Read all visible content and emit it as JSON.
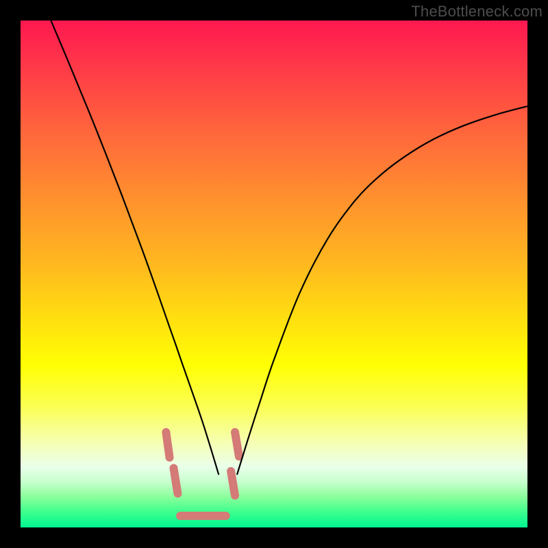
{
  "watermark": "TheBottleneck.com",
  "chart_data": {
    "type": "line",
    "title": "",
    "xlabel": "",
    "ylabel": "",
    "xlim": [
      0,
      100
    ],
    "ylim": [
      0,
      100
    ],
    "series": [
      {
        "name": "left-branch",
        "x": [
          6,
          10,
          15,
          20,
          24,
          27,
          29.4,
          30.6,
          31.8,
          33.1,
          34.5,
          36.0,
          37.5,
          39.1
        ],
        "values": [
          100,
          90.5,
          78.3,
          65.5,
          54.8,
          46.4,
          39.5,
          36.1,
          32.6,
          28.9,
          24.9,
          20.5,
          15.7,
          10.4
        ]
      },
      {
        "name": "right-branch",
        "x": [
          42.7,
          44.8,
          47.4,
          50.0,
          55.0,
          60.5,
          66.0,
          71.0,
          76.0,
          81.5,
          87.5,
          94.0,
          100.0
        ],
        "values": [
          10.4,
          17.2,
          25.3,
          33.1,
          46.1,
          56.8,
          64.5,
          69.5,
          73.3,
          76.6,
          79.3,
          81.5,
          83.1
        ]
      },
      {
        "name": "connector-pill-left-outer",
        "x": [
          28.7,
          29.4
        ],
        "values": [
          18.8,
          13.8
        ]
      },
      {
        "name": "connector-pill-left-inner",
        "x": [
          30.2,
          31.0
        ],
        "values": [
          11.7,
          6.7
        ]
      },
      {
        "name": "connector-pill-right-upper",
        "x": [
          42.3,
          43.1
        ],
        "values": [
          18.8,
          14.0
        ]
      },
      {
        "name": "connector-pill-right-lower",
        "x": [
          41.5,
          42.3
        ],
        "values": [
          11.1,
          6.3
        ]
      },
      {
        "name": "valley-floor",
        "x": [
          31.5,
          33.0,
          34.5,
          36.0,
          37.5,
          39.0,
          40.5
        ],
        "values": [
          2.3,
          2.3,
          2.3,
          2.3,
          2.3,
          2.3,
          2.3
        ]
      }
    ],
    "colors": {
      "curve": "#000000",
      "dot": "#d47a77",
      "floor": "#d47a77"
    },
    "stroke_widths": {
      "curve": 2.2,
      "connector": 12,
      "floor": 12
    }
  }
}
